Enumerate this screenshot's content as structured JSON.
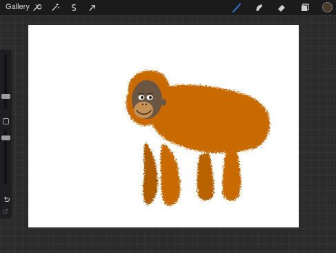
{
  "topbar": {
    "gallery_label": "Gallery",
    "left_tools": [
      "wrench-icon",
      "magic-wand-icon",
      "selection-icon",
      "transform-icon"
    ],
    "right_tools": [
      "brush-icon",
      "smudge-icon",
      "eraser-icon",
      "layers-icon"
    ],
    "active_tool": "brush-icon",
    "active_color": "#4a3a2a",
    "accent_color": "#2f7fe6"
  },
  "sidebar": {
    "brush_size_level": 0.55,
    "opacity_level": 0.4
  },
  "canvas": {
    "background": "#ffffff",
    "subject": "orangutan-illustration",
    "fur_color": "#c96b00",
    "face_color": "#6b5644"
  }
}
